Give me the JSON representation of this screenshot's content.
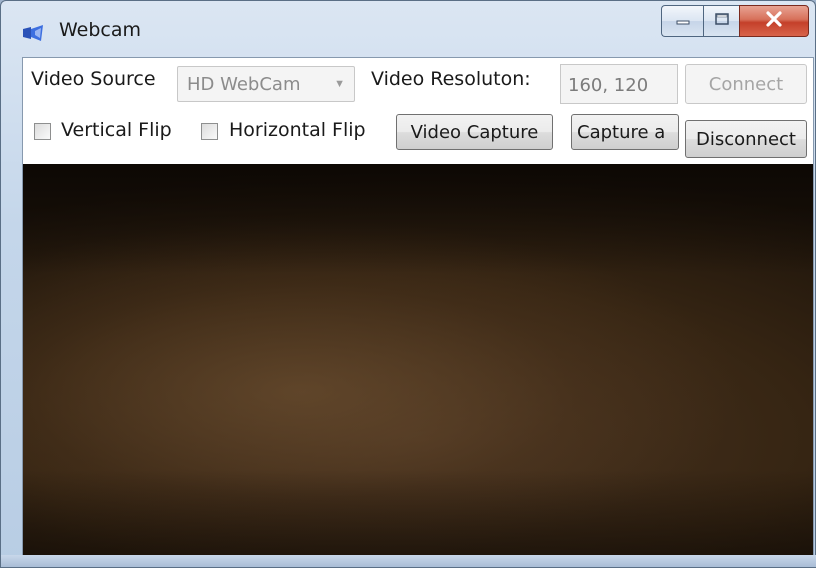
{
  "window": {
    "title": "Webcam",
    "icons": {
      "app": "webcam-app-icon",
      "minimize": "minimize-icon",
      "maximize": "maximize-icon",
      "close": "close-icon"
    }
  },
  "toolbar": {
    "video_source_label": "Video Source",
    "video_source_value": "HD WebCam",
    "resolution_label": "Video Resoluton:",
    "resolution_value": "160, 120",
    "connect_label": "Connect",
    "vertical_flip_label": "Vertical Flip",
    "vertical_flip_checked": false,
    "horizontal_flip_label": "Horizontal Flip",
    "horizontal_flip_checked": false,
    "video_capture_label": "Video Capture",
    "capture_label": "Capture a",
    "disconnect_label": "Disconnect"
  },
  "colors": {
    "close_button": "#c4402a",
    "frame": "#b8cde4",
    "video_dark": "#1c130a",
    "video_mid": "#4a3420"
  }
}
